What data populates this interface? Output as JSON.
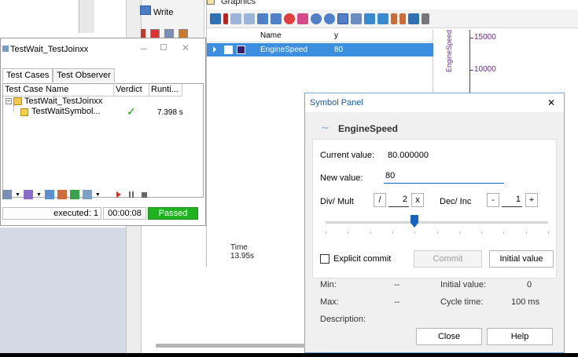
{
  "write_window": {
    "title": "Write"
  },
  "graphics_window": {
    "title": "Graphics",
    "columns": [
      "Name",
      "y"
    ],
    "rows": [
      {
        "name": "EngineSpeed",
        "value": "80"
      }
    ],
    "time_label": "Time",
    "time_value": "13.95s",
    "y_axis_label": "EngineSpeed",
    "y_ticks": [
      "15000",
      "10000"
    ]
  },
  "test_window": {
    "title": "TestWait_TestJoinxx",
    "tabs": [
      "Test Cases",
      "Test Observer"
    ],
    "columns": [
      "Test Case Name",
      "Verdict",
      "Runti..."
    ],
    "tree": {
      "parent": "TestWait_TestJoinxx",
      "child": "TestWaitSymbol...",
      "verdict_mark": "✓",
      "runtime": "7.398 s"
    },
    "status": {
      "executed": "executed: 1",
      "time": "00:00:08",
      "verdict": "Passed"
    }
  },
  "symbol_panel": {
    "title": "Symbol Panel",
    "close_glyph": "✕",
    "symbol_name": "EngineSpeed",
    "current_value_label": "Current value:",
    "current_value": "80.000000",
    "new_value_label": "New value:",
    "new_value": "80",
    "divmult_label": "Div/ Mult",
    "div_button": "/",
    "divmult_value": "2",
    "mult_button": "x",
    "decinc_label": "Dec/ Inc",
    "dec_button": "-",
    "decinc_value": "1",
    "inc_button": "+",
    "slider_position": 0.4,
    "explicit_commit_label": "Explicit commit",
    "commit_button": "Commit",
    "initial_value_button": "Initial value",
    "min_label": "Min:",
    "min_value": "--",
    "initial_value_label": "Initial value:",
    "initial_value": "0",
    "max_label": "Max:",
    "max_value": "--",
    "cycle_time_label": "Cycle time:",
    "cycle_time": "100 ms",
    "description_label": "Description:",
    "close_button": "Close",
    "help_button": "Help"
  },
  "colors": {
    "selection_blue": "#3c8fde",
    "passed_green": "#1fb31f",
    "slider_thumb": "#1565c0",
    "axis_purple": "#6a2a8a"
  }
}
